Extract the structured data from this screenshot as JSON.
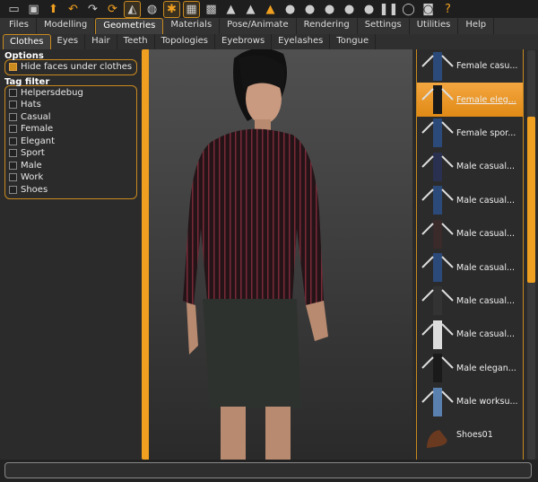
{
  "toolbar": {
    "icons": [
      "undo-icon",
      "redo-icon"
    ],
    "help_label": "?"
  },
  "main_tabs": [
    "Files",
    "Modelling",
    "Geometries",
    "Materials",
    "Pose/Animate",
    "Rendering",
    "Settings",
    "Utilities",
    "Help"
  ],
  "main_active": "Geometries",
  "sub_tabs": [
    "Clothes",
    "Eyes",
    "Hair",
    "Teeth",
    "Topologies",
    "Eyebrows",
    "Eyelashes",
    "Tongue"
  ],
  "sub_active": "Clothes",
  "options": {
    "title": "Options",
    "hide_faces": {
      "label": "Hide faces under clothes",
      "checked": true
    }
  },
  "tag_filter": {
    "title": "Tag filter",
    "tags": [
      "Helpersdebug",
      "Hats",
      "Casual",
      "Female",
      "Elegant",
      "Sport",
      "Male",
      "Work",
      "Shoes"
    ]
  },
  "clothes_list": [
    {
      "label": "Female casu...",
      "selected": false
    },
    {
      "label": "Female eleg...",
      "selected": true
    },
    {
      "label": "Female spor...",
      "selected": false
    },
    {
      "label": "Male casual...",
      "selected": false
    },
    {
      "label": "Male casual...",
      "selected": false
    },
    {
      "label": "Male casual...",
      "selected": false
    },
    {
      "label": "Male casual...",
      "selected": false
    },
    {
      "label": "Male casual...",
      "selected": false
    },
    {
      "label": "Male casual...",
      "selected": false
    },
    {
      "label": "Male elegan...",
      "selected": false
    },
    {
      "label": "Male worksu...",
      "selected": false
    },
    {
      "label": "Shoes01",
      "selected": false
    }
  ],
  "colors": {
    "accent": "#f0a020",
    "selected_item": "#e8901c"
  }
}
